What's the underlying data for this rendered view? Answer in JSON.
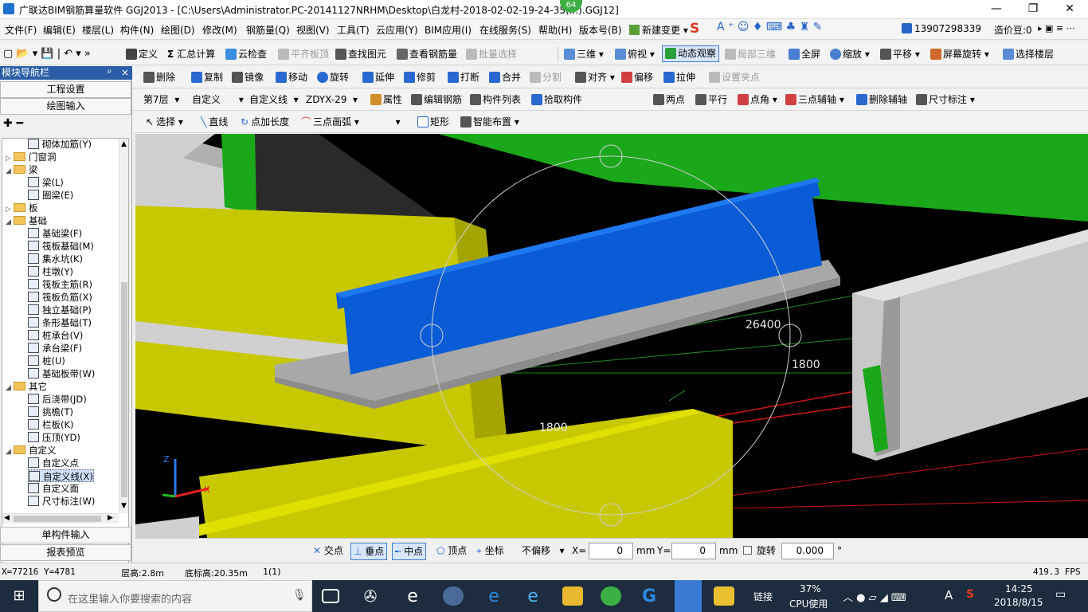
{
  "titlebar": {
    "title": "广联达BIM钢筋算量软件 GGJ2013 - [C:\\Users\\Administrator.PC-20141127NRHM\\Desktop\\白龙村-2018-02-02-19-24-35(...).GGJ12]",
    "badge": "64",
    "btn_min": "—",
    "btn_max": "❐",
    "btn_close": "✕"
  },
  "menu": [
    "文件(F)",
    "编辑(E)",
    "楼层(L)",
    "构件(N)",
    "绘图(D)",
    "修改(M)",
    "钢筋量(Q)",
    "视图(V)",
    "工具(T)",
    "云应用(Y)",
    "BIM应用(I)",
    "在线服务(S)",
    "帮助(H)",
    "版本号(B)",
    "新建变更",
    "13907298339",
    "造价豆:0"
  ],
  "toolbar1": [
    "定义",
    "汇总计算",
    "云检查",
    "平齐板顶",
    "查找图元",
    "查看钢筋量",
    "批量选择",
    "三维",
    "俯视",
    "动态观察",
    "局部三维",
    "全屏",
    "缩放",
    "平移",
    "屏幕旋转",
    "选择楼层"
  ],
  "toolbar2": [
    "删除",
    "复制",
    "镜像",
    "移动",
    "旋转",
    "延伸",
    "修剪",
    "打断",
    "合并",
    "分割",
    "对齐",
    "偏移",
    "拉伸",
    "设置夹点"
  ],
  "toolbar3": {
    "floor": "第7层",
    "cat": "自定义",
    "type": "自定义线",
    "name": "ZDYX-29",
    "items": [
      "属性",
      "编辑钢筋",
      "构件列表",
      "拾取构件",
      "两点",
      "平行",
      "点角",
      "三点辅轴",
      "删除辅轴",
      "尺寸标注"
    ]
  },
  "toolbar4": [
    "选择",
    "直线",
    "点加长度",
    "三点画弧",
    "矩形",
    "智能布置"
  ],
  "nav": {
    "header": "模块导航栏",
    "pin": "ᵖ",
    "close": "×",
    "b1": "工程设置",
    "b2": "绘图输入",
    "b3": "单构件输入",
    "b4": "报表预览",
    "tree": [
      {
        "t": "砌体加筋(Y)",
        "lv": 2
      },
      {
        "t": "门窗洞",
        "lv": 0,
        "f": true,
        "e": "▷"
      },
      {
        "t": "梁",
        "lv": 0,
        "f": true,
        "e": "◢"
      },
      {
        "t": "梁(L)",
        "lv": 2
      },
      {
        "t": "圈梁(E)",
        "lv": 2
      },
      {
        "t": "板",
        "lv": 0,
        "f": true,
        "e": "▷"
      },
      {
        "t": "基础",
        "lv": 0,
        "f": true,
        "e": "◢"
      },
      {
        "t": "基础梁(F)",
        "lv": 2
      },
      {
        "t": "筏板基础(M)",
        "lv": 2
      },
      {
        "t": "集水坑(K)",
        "lv": 2
      },
      {
        "t": "柱墩(Y)",
        "lv": 2
      },
      {
        "t": "筏板主筋(R)",
        "lv": 2
      },
      {
        "t": "筏板负筋(X)",
        "lv": 2
      },
      {
        "t": "独立基础(P)",
        "lv": 2
      },
      {
        "t": "条形基础(T)",
        "lv": 2
      },
      {
        "t": "桩承台(V)",
        "lv": 2
      },
      {
        "t": "承台梁(F)",
        "lv": 2
      },
      {
        "t": "桩(U)",
        "lv": 2
      },
      {
        "t": "基础板带(W)",
        "lv": 2
      },
      {
        "t": "其它",
        "lv": 0,
        "f": true,
        "e": "◢"
      },
      {
        "t": "后浇带(JD)",
        "lv": 2
      },
      {
        "t": "挑檐(T)",
        "lv": 2
      },
      {
        "t": "栏板(K)",
        "lv": 2
      },
      {
        "t": "压顶(YD)",
        "lv": 2
      },
      {
        "t": "自定义",
        "lv": 0,
        "f": true,
        "e": "◢"
      },
      {
        "t": "自定义点",
        "lv": 2
      },
      {
        "t": "自定义线(X)",
        "lv": 2,
        "sel": true
      },
      {
        "t": "自定义面",
        "lv": 2
      },
      {
        "t": "尺寸标注(W)",
        "lv": 2
      }
    ]
  },
  "viewport": {
    "dim1": "26400",
    "dim2": "1800",
    "dim3": "1800",
    "colors": {
      "beam_blue": "#0a5cd6",
      "wall_yellow": "#c8c800",
      "column_green": "#1aa81a",
      "slab_gray": "#a8a8a8"
    }
  },
  "snapbar": {
    "items": [
      "交点",
      "垂点",
      "中点",
      "顶点",
      "坐标"
    ],
    "offset": "不偏移",
    "xl": "X=",
    "xv": "0",
    "yl": "Y=",
    "yv": "0",
    "unit": "mm",
    "rot": "旋转",
    "rotv": "0.000",
    "deg": "°"
  },
  "status": {
    "coords": "X=77216 Y=4781",
    "h": "层高:2.8m",
    "b": "底标高:20.35m",
    "n": "1(1)",
    "fps": "419.3 FPS"
  },
  "taskbar": {
    "search": "在这里输入你要搜索的内容",
    "lk": "链接",
    "cpu": "37%",
    "cpu_l": "CPU使用",
    "time": "14:25",
    "date": "2018/8/15",
    "lang": "A"
  }
}
